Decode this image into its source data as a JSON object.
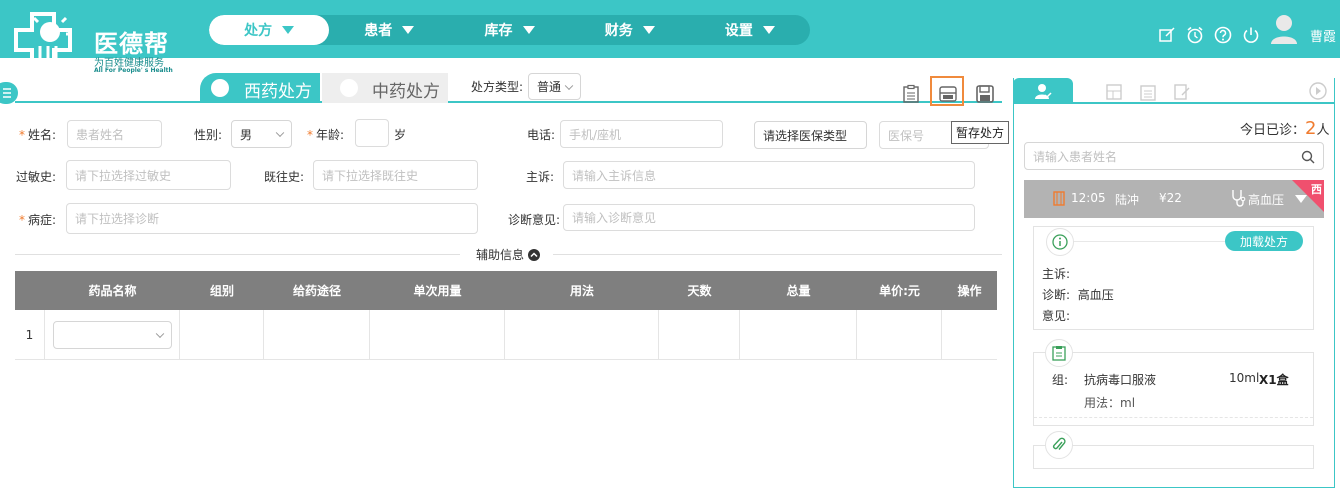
{
  "brand": {
    "title": "医德帮",
    "subtitle": "为百姓健康服务",
    "tagline": "All For People' s Health"
  },
  "nav": {
    "items": [
      {
        "label": "处方",
        "active": true
      },
      {
        "label": "患者",
        "active": false
      },
      {
        "label": "库存",
        "active": false
      },
      {
        "label": "财务",
        "active": false
      },
      {
        "label": "设置",
        "active": false
      }
    ]
  },
  "user": {
    "name": "曹霞",
    "header_icons": [
      "edit-icon",
      "alarm-icon",
      "help-icon",
      "power-icon"
    ]
  },
  "tabs": {
    "western": "西药处方",
    "chinese": "中药处方",
    "rx_type_label": "处方类型:",
    "rx_type_value": "普通"
  },
  "toolbar": {
    "icons": [
      "clipboard-icon",
      "print-icon",
      "save-icon"
    ],
    "tooltip": "暂存处方"
  },
  "form": {
    "name_label": "姓名:",
    "name_placeholder": "患者姓名",
    "gender_label": "性别:",
    "gender_value": "男",
    "age_label": "年龄:",
    "age_unit": "岁",
    "phone_label": "电话:",
    "phone_placeholder": "手机/座机",
    "insurance_type": "请选择医保类型",
    "insurance_no_placeholder": "医保号",
    "allergy_label": "过敏史:",
    "allergy_placeholder": "请下拉选择过敏史",
    "history_label": "既往史:",
    "history_placeholder": "请下拉选择既往史",
    "complaint_label": "主诉:",
    "complaint_placeholder": "请输入主诉信息",
    "disease_label": "病症:",
    "disease_placeholder": "请下拉选择诊断",
    "opinion_label": "诊断意见:",
    "opinion_placeholder": "请输入诊断意见",
    "aux_label": "辅助信息"
  },
  "table": {
    "headers": [
      "药品名称",
      "组别",
      "给药途径",
      "单次用量",
      "用法",
      "天数",
      "总量",
      "单价:元",
      "操作"
    ],
    "rows": [
      {
        "index": "1"
      }
    ]
  },
  "right_panel": {
    "today_label": "今日已诊：",
    "today_count": "2",
    "today_unit": "人",
    "search_placeholder": "请输入患者姓名",
    "patient": {
      "time": "12:05",
      "name": "陆冲",
      "price": "¥22",
      "diagnosis": "高血压",
      "badge": "西"
    },
    "card1": {
      "load_button": "加载处方",
      "complaint_label": "主诉:",
      "complaint_value": "",
      "diagnosis_label": "诊断:",
      "diagnosis_value": "高血压",
      "opinion_label": "意见:",
      "opinion_value": ""
    },
    "card2": {
      "group_label": "组:",
      "drug_name": "抗病毒口服液",
      "drug_spec": "10ml",
      "drug_qty": "X1盒",
      "usage_label": "用法：ml"
    }
  }
}
